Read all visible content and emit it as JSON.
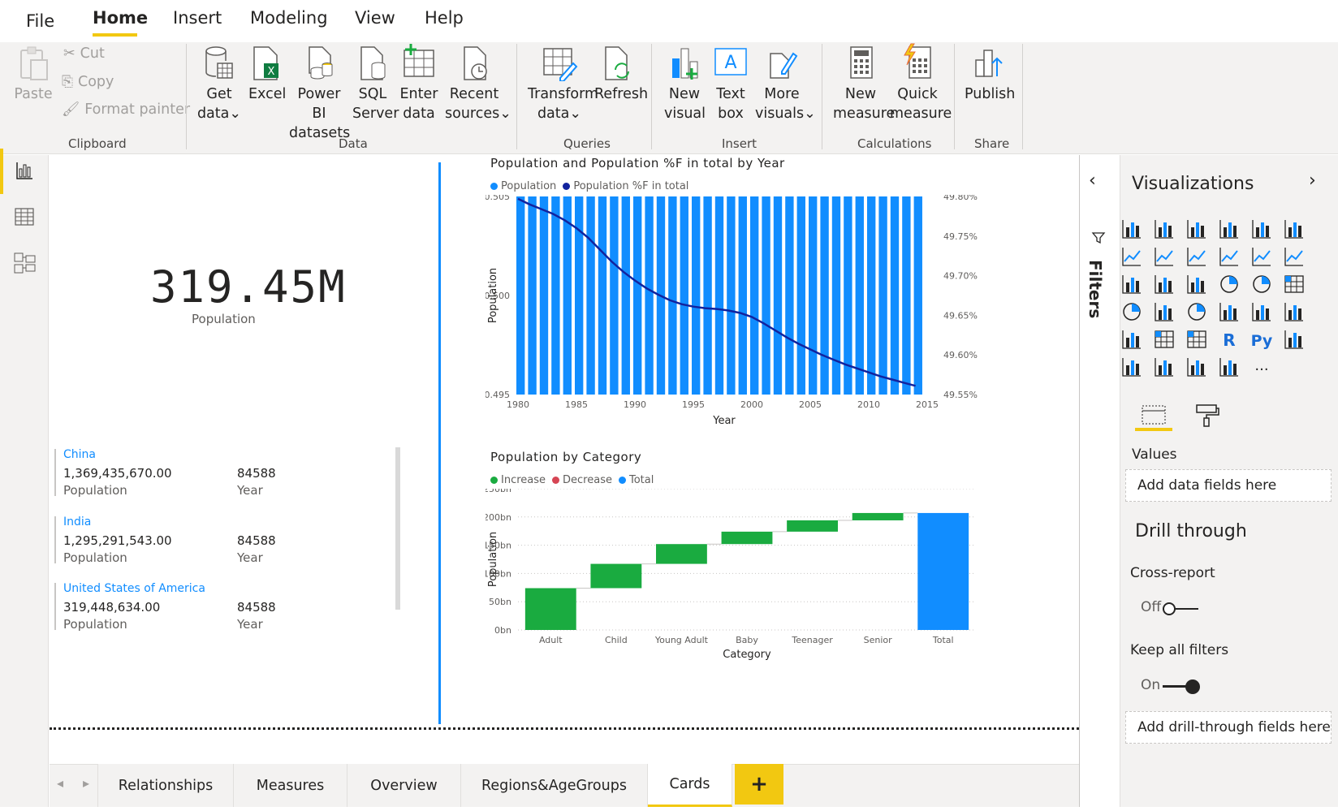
{
  "menu": {
    "items": [
      "File",
      "Home",
      "Insert",
      "Modeling",
      "View",
      "Help"
    ],
    "active": "Home"
  },
  "ribbon": {
    "clipboard": {
      "paste": "Paste",
      "cut": "Cut",
      "copy": "Copy",
      "format_painter": "Format painter",
      "group": "Clipboard"
    },
    "data": {
      "get_data": [
        "Get",
        "data"
      ],
      "excel": "Excel",
      "power_bi": [
        "Power BI",
        "datasets"
      ],
      "sql": [
        "SQL",
        "Server"
      ],
      "enter": [
        "Enter",
        "data"
      ],
      "recent": [
        "Recent",
        "sources"
      ],
      "group": "Data"
    },
    "queries": {
      "transform": [
        "Transform",
        "data"
      ],
      "refresh": "Refresh",
      "group": "Queries"
    },
    "insert": {
      "new_visual": [
        "New",
        "visual"
      ],
      "text_box": [
        "Text",
        "box"
      ],
      "more_visuals": [
        "More",
        "visuals"
      ],
      "group": "Insert"
    },
    "calculations": {
      "new_measure": [
        "New",
        "measure"
      ],
      "quick_measure": [
        "Quick",
        "measure"
      ],
      "group": "Calculations"
    },
    "share": {
      "publish": "Publish",
      "group": "Share"
    }
  },
  "card": {
    "value": "319.45M",
    "label": "Population"
  },
  "multirow_card": [
    {
      "title": "China",
      "value": "1,369,435,670.00",
      "value_label": "Population",
      "year": "84588",
      "year_label": "Year"
    },
    {
      "title": "India",
      "value": "1,295,291,543.00",
      "value_label": "Population",
      "year": "84588",
      "year_label": "Year"
    },
    {
      "title": "United States of America",
      "value": "319,448,634.00",
      "value_label": "Population",
      "year": "84588",
      "year_label": "Year"
    }
  ],
  "chart_data": [
    {
      "type": "bar",
      "title": "Population and Population %F in total by Year",
      "xlabel": "Year",
      "ylabel": "Population",
      "ylim": [
        0.495,
        0.505
      ],
      "y_ticks": [
        "0.505",
        "0.500",
        "0.495"
      ],
      "y2_ticks": [
        "49.80%",
        "49.75%",
        "49.70%",
        "49.65%",
        "49.60%",
        "49.55%"
      ],
      "y2lim": [
        49.55,
        49.8
      ],
      "x_ticks": [
        "1980",
        "1985",
        "1990",
        "1995",
        "2000",
        "2005",
        "2010",
        "2015"
      ],
      "x": [
        1980,
        1981,
        1982,
        1983,
        1984,
        1985,
        1986,
        1987,
        1988,
        1989,
        1990,
        1991,
        1992,
        1993,
        1994,
        1995,
        1996,
        1997,
        1998,
        1999,
        2000,
        2001,
        2002,
        2003,
        2004,
        2005,
        2006,
        2007,
        2008,
        2009,
        2010,
        2011,
        2012,
        2013,
        2014
      ],
      "series": [
        {
          "name": "Population",
          "color": "#118dff",
          "values": [
            0.505,
            0.505,
            0.505,
            0.505,
            0.505,
            0.505,
            0.505,
            0.505,
            0.505,
            0.505,
            0.505,
            0.505,
            0.505,
            0.505,
            0.505,
            0.505,
            0.505,
            0.505,
            0.505,
            0.505,
            0.505,
            0.505,
            0.505,
            0.505,
            0.505,
            0.505,
            0.505,
            0.505,
            0.505,
            0.505,
            0.505,
            0.505,
            0.505,
            0.505,
            0.505
          ]
        },
        {
          "name": "Population %F in total",
          "color": "#12239e",
          "axis": "secondary",
          "values": [
            49.797,
            49.79,
            49.784,
            49.778,
            49.77,
            49.76,
            49.748,
            49.733,
            49.718,
            49.705,
            49.694,
            49.684,
            49.676,
            49.669,
            49.664,
            49.661,
            49.659,
            49.658,
            49.656,
            49.653,
            49.648,
            49.64,
            49.631,
            49.622,
            49.614,
            49.607,
            49.6,
            49.594,
            49.588,
            49.583,
            49.578,
            49.573,
            49.569,
            49.565,
            49.561
          ]
        }
      ]
    },
    {
      "type": "waterfall",
      "title": "Population by Category",
      "xlabel": "Category",
      "ylabel": "Population",
      "ylim": [
        0,
        250
      ],
      "y_ticks": [
        "250bn",
        "200bn",
        "150bn",
        "100bn",
        "50bn",
        "0bn"
      ],
      "legend": [
        {
          "name": "Increase",
          "color": "#1aab40"
        },
        {
          "name": "Decrease",
          "color": "#d64554"
        },
        {
          "name": "Total",
          "color": "#118dff"
        }
      ],
      "categories": [
        "Adult",
        "Child",
        "Young Adult",
        "Baby",
        "Teenager",
        "Senior",
        "Total"
      ],
      "values": [
        74,
        43,
        35,
        22,
        20,
        13,
        207
      ]
    }
  ],
  "filters": {
    "label": "Filters"
  },
  "visualizations": {
    "title": "Visualizations",
    "values_label": "Values",
    "add_data": "Add data fields here",
    "drill_through": "Drill through",
    "cross_report": "Cross-report",
    "cross_report_state": "Off",
    "keep_filters": "Keep all filters",
    "keep_filters_state": "On",
    "add_drill": "Add drill-through fields here",
    "r_icon": "R",
    "py_icon": "Py",
    "more_icon": "..."
  },
  "tabs": [
    "Relationships",
    "Measures",
    "Overview",
    "Regions&AgeGroups",
    "Cards"
  ],
  "active_tab": "Cards",
  "add_tab": "+"
}
